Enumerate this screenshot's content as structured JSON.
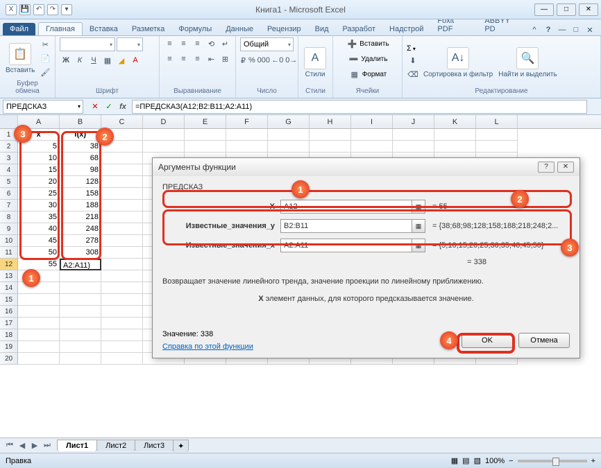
{
  "window": {
    "title": "Книга1 - Microsoft Excel"
  },
  "tabs": {
    "file": "Файл",
    "items": [
      "Главная",
      "Вставка",
      "Разметка",
      "Формулы",
      "Данные",
      "Рецензир",
      "Вид",
      "Разработ",
      "Надстрой",
      "Foxit PDF",
      "ABBYY PD"
    ],
    "active_index": 0
  },
  "ribbon": {
    "paste": "Вставить",
    "groups": [
      "Буфер обмена",
      "Шрифт",
      "Выравнивание",
      "Число",
      "Стили",
      "Ячейки",
      "Редактирование"
    ],
    "number_format": "Общий",
    "styles": "Стили",
    "cells": {
      "insert": "Вставить",
      "delete": "Удалить",
      "format": "Формат"
    },
    "sort": "Сортировка и фильтр",
    "find": "Найти и выделить",
    "sigma": "Σ"
  },
  "formula_bar": {
    "name_box": "ПРЕДСКАЗ",
    "formula": "=ПРЕДСКАЗ(A12;B2:B11;A2:A11)"
  },
  "columns": [
    "A",
    "B",
    "C",
    "D",
    "E",
    "F",
    "G",
    "H",
    "I",
    "J",
    "K",
    "L"
  ],
  "sheet": {
    "headers": {
      "A": "x",
      "B": "f(x)"
    },
    "data": [
      {
        "row": 2,
        "x": 5,
        "fx": 38
      },
      {
        "row": 3,
        "x": 10,
        "fx": 68
      },
      {
        "row": 4,
        "x": 15,
        "fx": 98
      },
      {
        "row": 5,
        "x": 20,
        "fx": 128
      },
      {
        "row": 6,
        "x": 25,
        "fx": 158
      },
      {
        "row": 7,
        "x": 30,
        "fx": 188
      },
      {
        "row": 8,
        "x": 35,
        "fx": 218
      },
      {
        "row": 9,
        "x": 40,
        "fx": 248
      },
      {
        "row": 10,
        "x": 45,
        "fx": 278
      },
      {
        "row": 11,
        "x": 50,
        "fx": 308
      }
    ],
    "edit_row": {
      "row": 12,
      "x": 55,
      "display": "A2:A11)"
    }
  },
  "dialog": {
    "title": "Аргументы функции",
    "func_name": "ПРЕДСКАЗ",
    "args": [
      {
        "label": "X",
        "value": "A12",
        "result": "= 55"
      },
      {
        "label": "Известные_значения_y",
        "value": "B2:B11",
        "result": "= {38;68;98;128;158;188;218;248;2..."
      },
      {
        "label": "Известные_значения_x",
        "value": "A2:A11",
        "result": "= {5;10;15;20;25;30;35;40;45;50}"
      }
    ],
    "calc_result": "= 338",
    "description": "Возвращает значение линейного тренда, значение проекции по линейному приближению.",
    "arg_desc_label": "X",
    "arg_desc": "элемент данных, для которого предсказывается значение.",
    "value_label": "Значение:",
    "value": "338",
    "help_link": "Справка по этой функции",
    "ok": "OK",
    "cancel": "Отмена"
  },
  "sheets": {
    "active": "Лист1",
    "others": [
      "Лист2",
      "Лист3"
    ]
  },
  "status": {
    "mode": "Правка",
    "zoom": "100%"
  }
}
